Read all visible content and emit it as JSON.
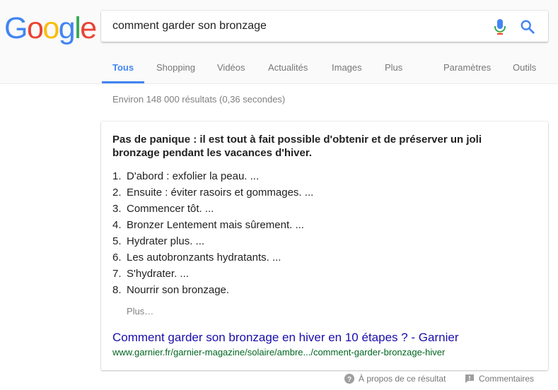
{
  "header": {
    "logo": [
      "G",
      "o",
      "o",
      "g",
      "l",
      "e"
    ],
    "logo_colors": [
      "#4285f4",
      "#ea4335",
      "#fbbc05",
      "#4285f4",
      "#34a853",
      "#ea4335"
    ],
    "search": {
      "value": "comment garder son bronzage"
    },
    "tabs": [
      {
        "label": "Tous",
        "active": true
      },
      {
        "label": "Shopping"
      },
      {
        "label": "Vidéos"
      },
      {
        "label": "Actualités"
      },
      {
        "label": "Images"
      },
      {
        "label": "Plus"
      },
      {
        "label": "Paramètres"
      },
      {
        "label": "Outils"
      }
    ]
  },
  "stats": "Environ 148 000 résultats (0,36 secondes)",
  "featured": {
    "title": "Pas de panique : il est tout à fait possible d'obtenir et de préserver un joli bronzage pendant les vacances d'hiver.",
    "steps": [
      {
        "num": "1.",
        "text": "D'abord : exfolier la peau. ..."
      },
      {
        "num": "2.",
        "text": "Ensuite : éviter rasoirs et gommages. ..."
      },
      {
        "num": "3.",
        "text": "Commencer tôt. ..."
      },
      {
        "num": "4.",
        "text": "Bronzer Lentement mais sûrement. ..."
      },
      {
        "num": "5.",
        "text": "Hydrater plus. ..."
      },
      {
        "num": "6.",
        "text": "Les autobronzants hydratants. ..."
      },
      {
        "num": "7.",
        "text": "S'hydrater. ..."
      },
      {
        "num": "8.",
        "text": "Nourrir son bronzage."
      }
    ],
    "more_label": "Plus…",
    "result_title": "Comment garder son bronzage en hiver en 10 étapes ? - Garnier",
    "result_url": "www.garnier.fr/garnier-magazine/solaire/ambre.../comment-garder-bronzage-hiver"
  },
  "footer": {
    "about_label": "À propos de ce résultat",
    "feedback_label": "Commentaires"
  },
  "colors": {
    "accent": "#4285f4",
    "link": "#1a0dab",
    "url": "#006621"
  }
}
